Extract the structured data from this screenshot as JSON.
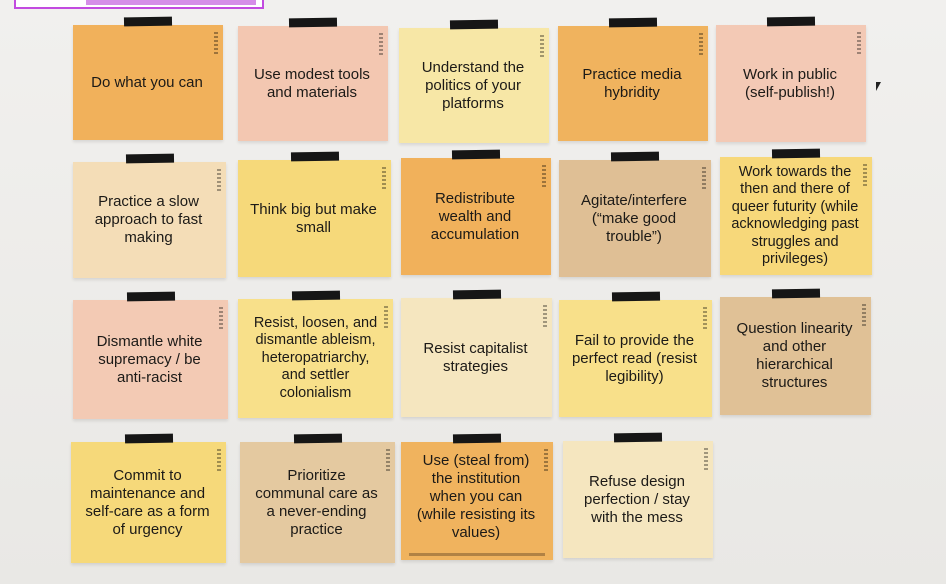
{
  "cards": [
    {
      "text": "Do what you can",
      "color": "#f1b15b"
    },
    {
      "text": "Use modest tools and materials",
      "color": "#f3c7b1"
    },
    {
      "text": "Understand the politics of your platforms",
      "color": "#f7e7a6"
    },
    {
      "text": "Practice media hybridity",
      "color": "#f0b35e"
    },
    {
      "text": "Work in public (self-publish!)",
      "color": "#f3c9b5"
    },
    {
      "text": "Practice a slow approach to fast making",
      "color": "#f4ddb7"
    },
    {
      "text": "Think big but make small",
      "color": "#f6d97a"
    },
    {
      "text": "Redistribute wealth and accumulation",
      "color": "#f1b15b"
    },
    {
      "text": "Agitate/interfere (“make good trouble”)",
      "color": "#dfbf95"
    },
    {
      "text": "Work towards the then and there of queer futurity (while acknowledging past struggles and privileges)",
      "color": "#f7d87a"
    },
    {
      "text": "Dismantle white supremacy / be anti-racist",
      "color": "#f3cab4"
    },
    {
      "text": "Resist, loosen, and dismantle ableism, heteropatriarchy, and settler colonialism",
      "color": "#f8e08a"
    },
    {
      "text": "Resist capitalist strategies",
      "color": "#f5e6bf"
    },
    {
      "text": "Fail to provide the perfect read (resist legibility)",
      "color": "#f8e08a"
    },
    {
      "text": "Question linearity and other hierarchical structures",
      "color": "#e0c196"
    },
    {
      "text": "Commit to maintenance and self-care as a form of urgency",
      "color": "#f6d97a"
    },
    {
      "text": "Prioritize communal care as a never-ending practice",
      "color": "#e4c9a0"
    },
    {
      "text": "Use (steal from) the institution when you can (while resisting its values)",
      "color": "#f0b35e"
    },
    {
      "text": "Refuse design perfection / stay with the mess",
      "color": "#f5e6bf"
    }
  ]
}
